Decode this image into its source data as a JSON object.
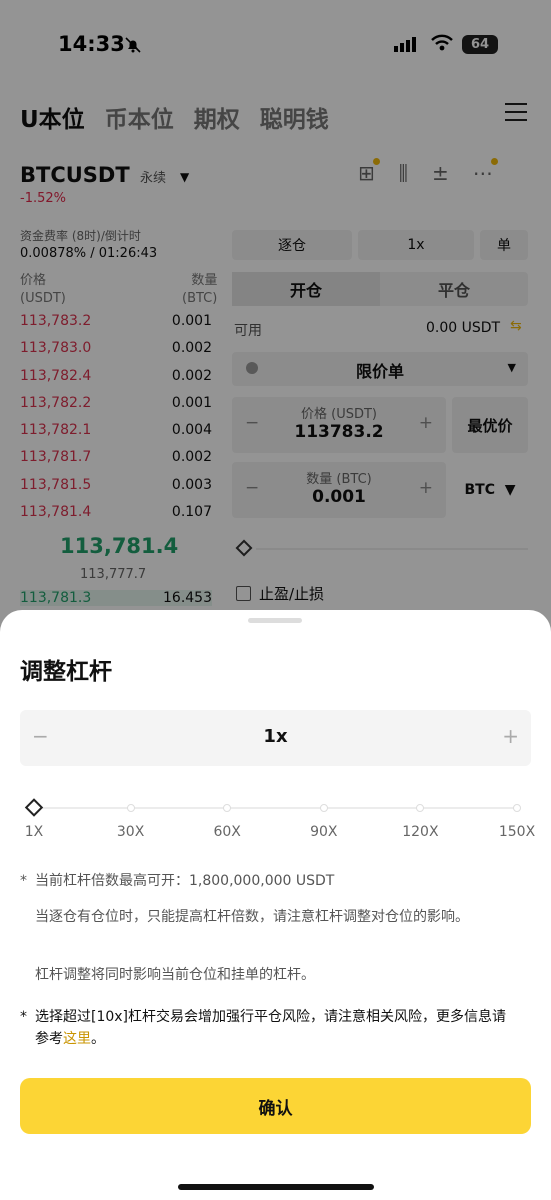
{
  "status": {
    "time": "14:33",
    "battery": "64"
  },
  "tabs": [
    "U本位",
    "币本位",
    "期权",
    "聪明钱"
  ],
  "symbol": {
    "name": "BTCUSDT",
    "type": "永续",
    "change": "-1.52%"
  },
  "funding": {
    "label": "资金费率 (8时)/倒计时",
    "value": "0.00878% / 01:26:43"
  },
  "orderbook": {
    "header_price": "价格",
    "header_price_unit": "(USDT)",
    "header_qty": "数量",
    "header_qty_unit": "(BTC)",
    "asks": [
      [
        "113,783.2",
        "0.001"
      ],
      [
        "113,783.0",
        "0.002"
      ],
      [
        "113,782.4",
        "0.002"
      ],
      [
        "113,782.2",
        "0.001"
      ],
      [
        "113,782.1",
        "0.004"
      ],
      [
        "113,781.7",
        "0.002"
      ],
      [
        "113,781.5",
        "0.003"
      ],
      [
        "113,781.4",
        "0.107"
      ]
    ],
    "last_price": "113,781.4",
    "mark_price": "113,777.7",
    "bid_price": "113,781.3",
    "bid_qty": "16.453"
  },
  "trade": {
    "margin_mode": "逐仓",
    "leverage": "1x",
    "position_mode": "单",
    "open": "开仓",
    "close": "平仓",
    "available_label": "可用",
    "available_value": "0.00 USDT",
    "order_type": "限价单",
    "price_label": "价格 (USDT)",
    "price_value": "113783.2",
    "best_price": "最优价",
    "qty_label": "数量 (BTC)",
    "qty_value": "0.001",
    "qty_unit": "BTC",
    "tpsl": "止盈/止损"
  },
  "sheet": {
    "title": "调整杠杆",
    "leverage_value": "1x",
    "slider_position": 0,
    "ticks": [
      "1X",
      "30X",
      "60X",
      "90X",
      "120X",
      "150X"
    ],
    "note_max_label": "当前杠杆倍数最高可开：",
    "note_max_value": "1,800,000,000 USDT",
    "note_isolated": "当逐仓有仓位时，只能提高杠杆倍数，请注意杠杆调整对仓位的影响。",
    "note_affects": "杠杆调整将同时影响当前仓位和挂单的杠杆。",
    "note_risk": "选择超过[10x]杠杆交易会增加强行平仓风险，请注意相关风险，更多信息请参考",
    "note_link": "这里",
    "note_end": "。",
    "confirm": "确认"
  },
  "colors": {
    "accent": "#fcd535",
    "ask": "#d9334f",
    "bid": "#22a06b"
  }
}
